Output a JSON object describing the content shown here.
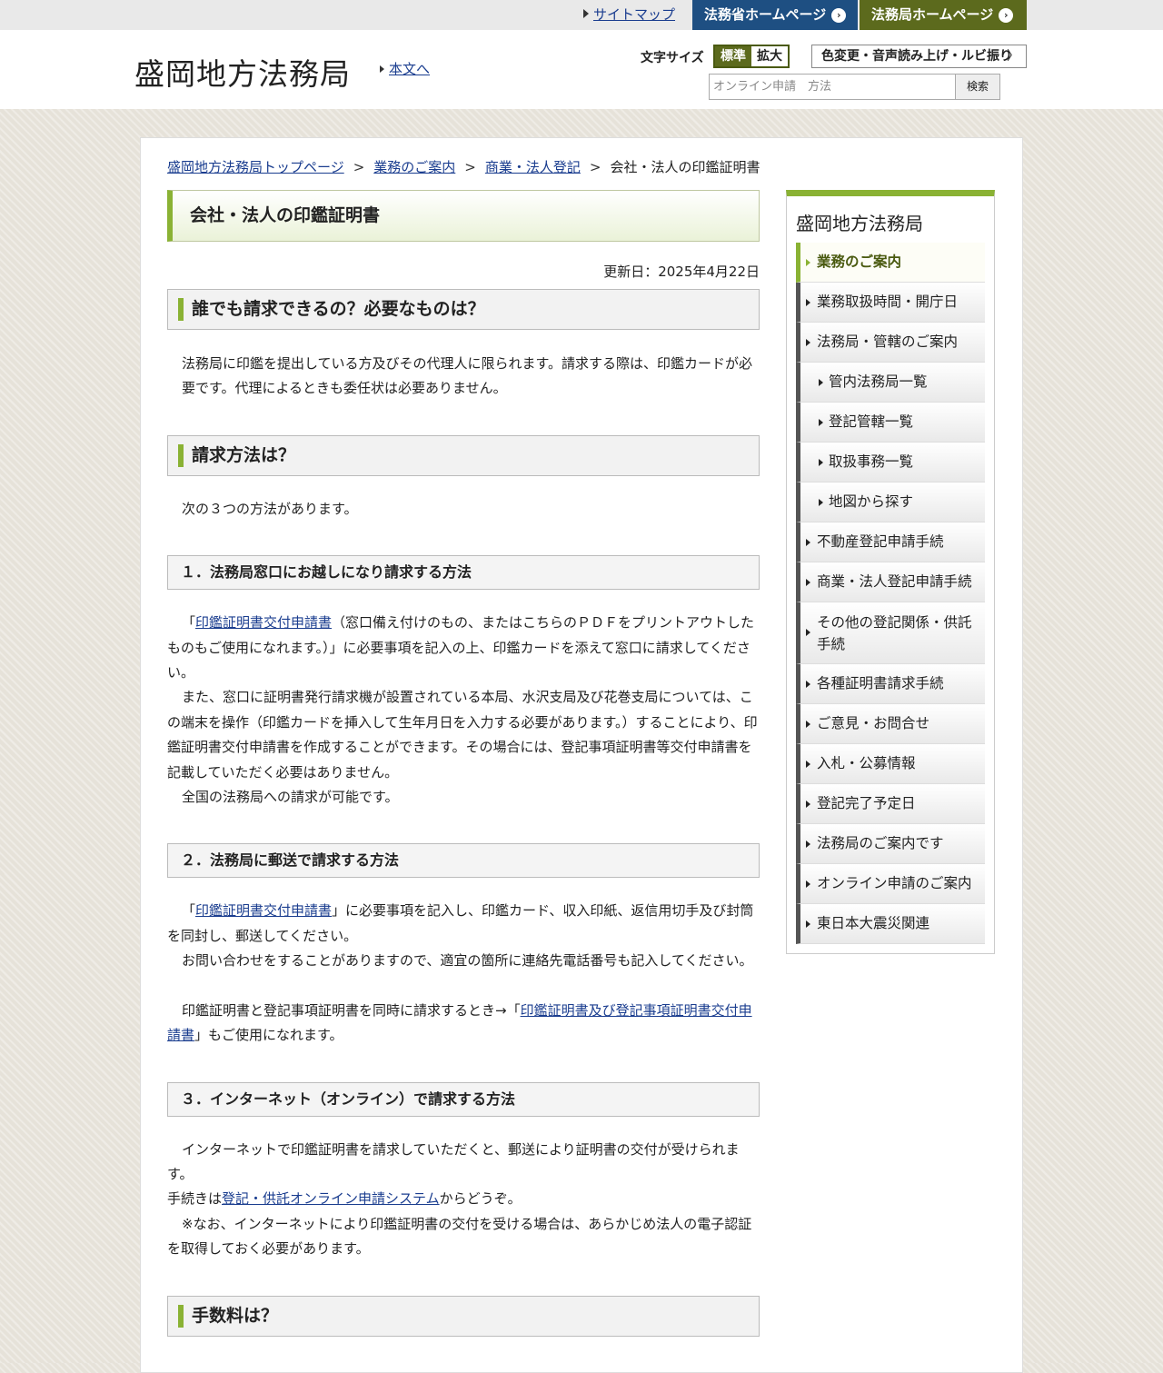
{
  "topbar": {
    "sitemap": "サイトマップ",
    "moj_home": "法務省ホームページ",
    "bureau_home": "法務局ホームページ"
  },
  "header": {
    "logo": "盛岡地方法務局",
    "skip_link": "本文へ",
    "font_size_label": "文字サイズ",
    "font_standard": "標準",
    "font_large": "拡大",
    "accessibility": "色変更・音声読み上げ・ルビ振り",
    "search_placeholder": "オンライン申請　方法",
    "search_button": "検索"
  },
  "breadcrumb": {
    "items": [
      "盛岡地方法務局トップページ",
      "業務のご案内",
      "商業・法人登記"
    ],
    "separator": ">",
    "current": "会社・法人の印鑑証明書"
  },
  "main": {
    "title": "会社・法人の印鑑証明書",
    "updated": "更新日：2025年4月22日",
    "s1": {
      "heading": "誰でも請求できるの？必要なものは？",
      "text": "法務局に印鑑を提出している方及びその代理人に限られます。請求する際は、印鑑カードが必要です。代理によるときも委任状は必要ありません。"
    },
    "s2": {
      "heading": "請求方法は？",
      "text": "次の３つの方法があります。",
      "m1": {
        "heading": "１．法務局窓口にお越しになり請求する方法",
        "open": "「",
        "link": "印鑑証明書交付申請書",
        "rest": "（窓口備え付けのもの、またはこちらのＰＤＦをプリントアウトしたものもご使用になれます。）」に必要事項を記入の上、印鑑カードを添えて窓口に請求してください。",
        "p2": "また、窓口に証明書発行請求機が設置されている本局、水沢支局及び花巻支局については、この端末を操作（印鑑カードを挿入して生年月日を入力する必要があります。）することにより、印鑑証明書交付申請書を作成することができます。その場合には、登記事項証明書等交付申請書を記載していただく必要はありません。",
        "p3": "全国の法務局への請求が可能です。"
      },
      "m2": {
        "heading": "２．法務局に郵送で請求する方法",
        "open": "「",
        "link": "印鑑証明書交付申請書",
        "rest": "」に必要事項を記入し、印鑑カード、収入印紙、返信用切手及び封筒を同封し、郵送してください。",
        "p2": "お問い合わせをすることがありますので、適宜の箇所に連絡先電話番号も記入してください。",
        "p3_pre": "印鑑証明書と登記事項証明書を同時に請求するとき→「",
        "p3_link": "印鑑証明書及び登記事項証明書交付申請書",
        "p3_post": "」もご使用になれます。"
      },
      "m3": {
        "heading": "３．インターネット（オンライン）で請求する方法",
        "p1": "インターネットで印鑑証明書を請求していただくと、郵送により証明書の交付が受けられます。",
        "p2_pre": "手続きは",
        "p2_link": "登記・供託オンライン申請システム",
        "p2_post": "からどうぞ。",
        "p3": "※なお、インターネットにより印鑑証明書の交付を受ける場合は、あらかじめ法人の電子認証を取得しておく必要があります。"
      }
    },
    "s3": {
      "heading": "手数料は？"
    }
  },
  "sidebar": {
    "title": "盛岡地方法務局",
    "items": [
      "業務のご案内",
      "業務取扱時間・開庁日",
      "法務局・管轄のご案内",
      "管内法務局一覧",
      "登記管轄一覧",
      "取扱事務一覧",
      "地図から探す",
      "不動産登記申請手続",
      "商業・法人登記申請手続",
      "その他の登記関係・供託手続",
      "各種証明書請求手続",
      "ご意見・お問合せ",
      "入札・公募情報",
      "登記完了予定日",
      "法務局のご案内です",
      "オンライン申請のご案内",
      "東日本大震災関連"
    ]
  },
  "colors": {
    "accent_green": "#8ab234",
    "moj_blue": "#1e4f82",
    "bureau_olive": "#5c6a1d"
  }
}
